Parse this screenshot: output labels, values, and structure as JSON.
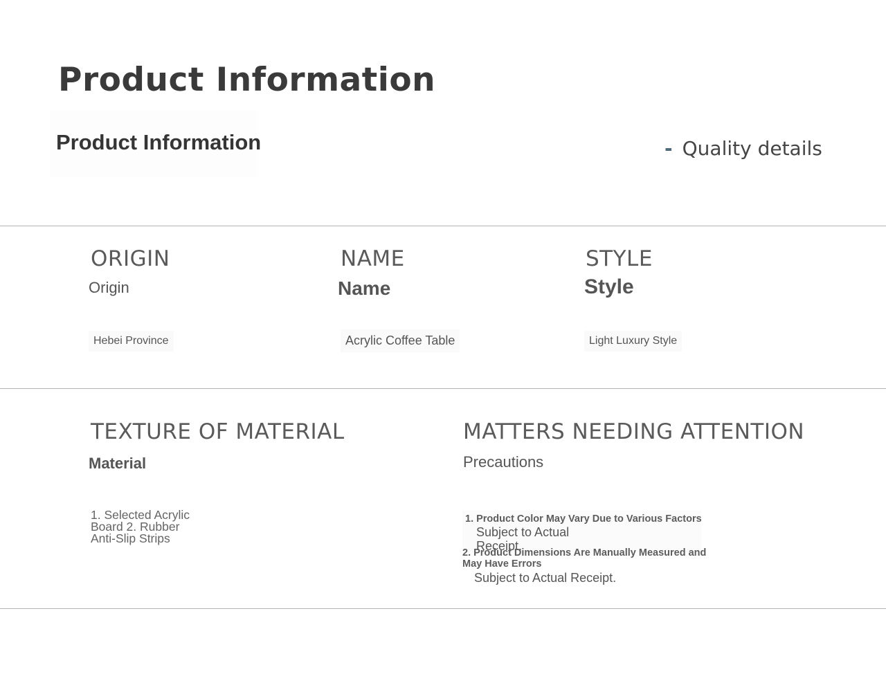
{
  "header": {
    "title": "Product Information",
    "subtitle": "Product Information",
    "quality_dash": "-",
    "quality_label": "Quality details"
  },
  "origin": {
    "caption": "ORIGIN",
    "label": "Origin",
    "value": "Hebei Province"
  },
  "name": {
    "caption": "NAME",
    "label": "Name",
    "value": "Acrylic Coffee Table"
  },
  "style": {
    "caption": "STYLE",
    "label": "Style",
    "value": "Light Luxury Style"
  },
  "material": {
    "caption": "TEXTURE OF MATERIAL",
    "label": "Material",
    "value": "1. Selected Acrylic Board 2. Rubber Anti-Slip Strips"
  },
  "attention": {
    "caption": "MATTERS NEEDING ATTENTION",
    "label": "Precautions",
    "note1": "1. Product Color May Vary Due to Various Factors",
    "note1_sub_a": "Subject to Actual",
    "note1_sub_b": "Receipt.",
    "note2_line1": "2. Product Dimensions Are Manually Measured and",
    "note2_line2": "May Have Errors",
    "note2_sub": "Subject to Actual Receipt."
  }
}
